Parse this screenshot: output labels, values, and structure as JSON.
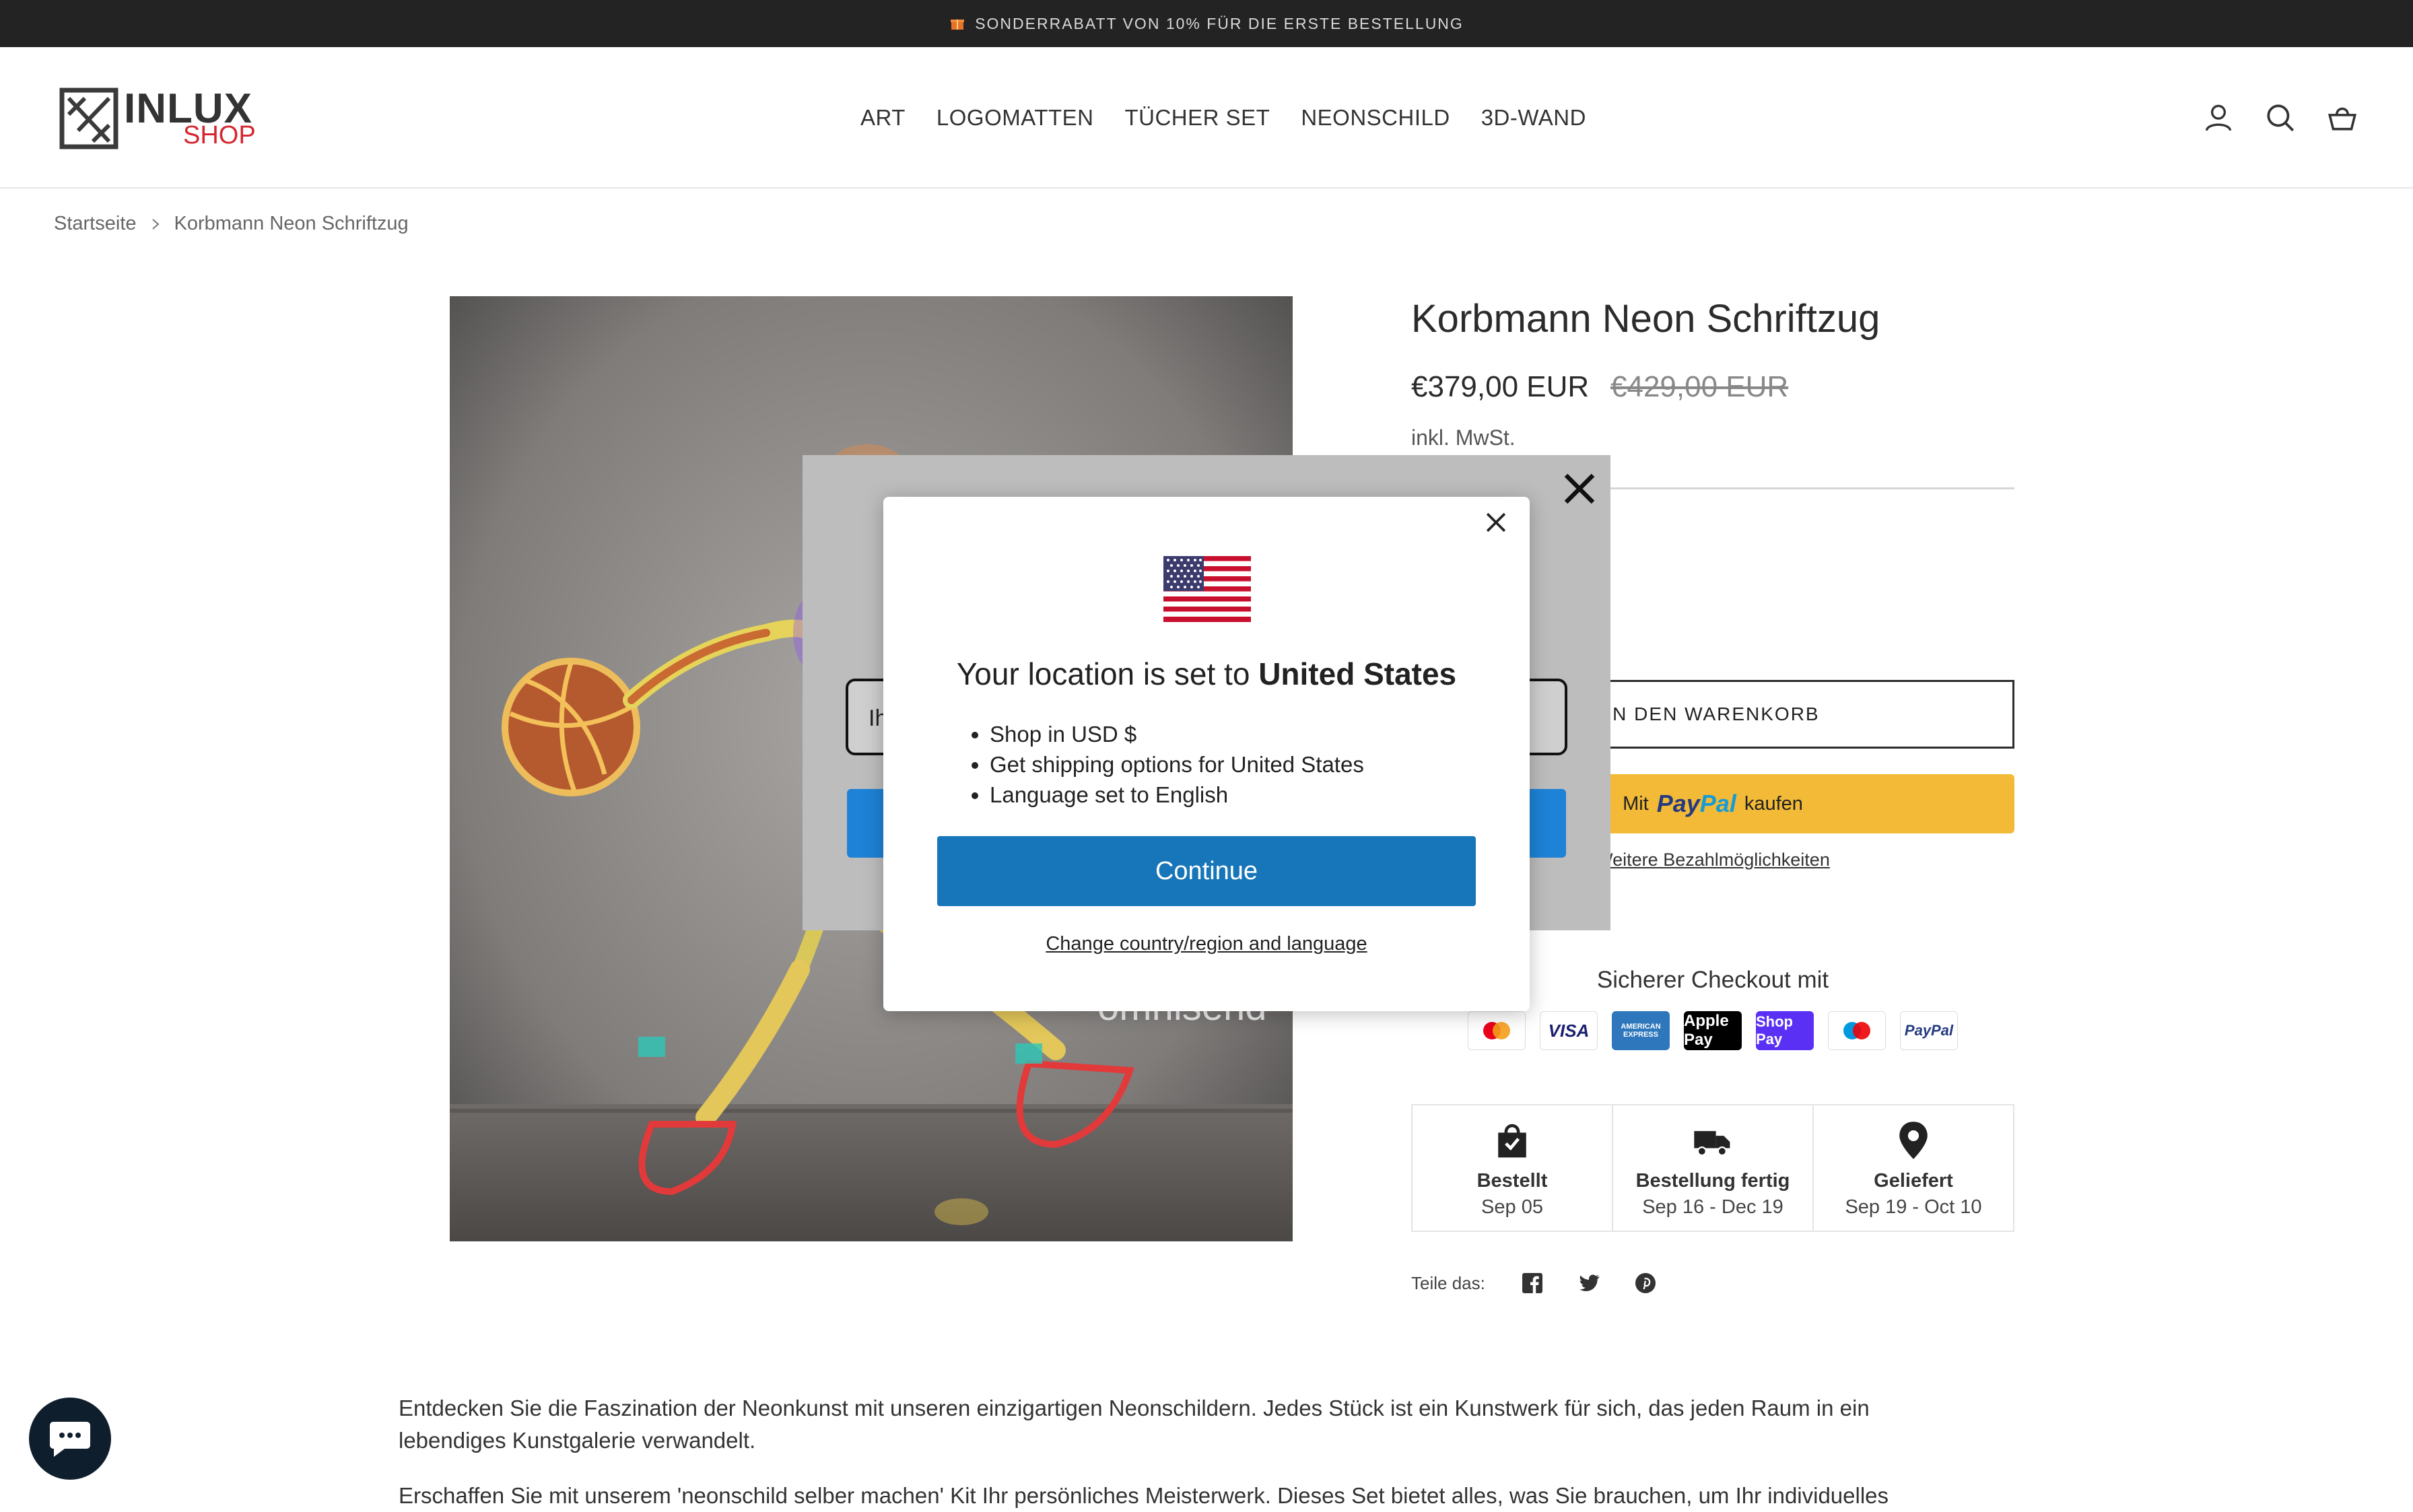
{
  "announcement": {
    "text": "SONDERRABATT VON 10% FÜR DIE ERSTE BESTELLUNG",
    "icon": "gift-icon"
  },
  "logo": {
    "main": "INLUX",
    "sub": "SHOP"
  },
  "nav": {
    "items": [
      "ART",
      "LOGOMATTEN",
      "TÜCHER SET",
      "NEONSCHILD",
      "3D-WAND"
    ]
  },
  "header_icons": [
    "account-icon",
    "search-icon",
    "cart-icon"
  ],
  "breadcrumb": {
    "home": "Startseite",
    "current": "Korbmann Neon Schriftzug"
  },
  "product": {
    "title": "Korbmann Neon Schriftzug",
    "price": "€379,00 EUR",
    "compare_price": "€429,00 EUR",
    "tax_note": "inkl. MwSt.",
    "add_to_cart": "IN DEN WARENKORB",
    "paypal_prefix": "Mit",
    "paypal_brand_a": "Pay",
    "paypal_brand_b": "Pal",
    "paypal_suffix": "kaufen",
    "more_payment": "Weitere Bezahlmöglichkeiten",
    "secure_checkout": "Sicherer Checkout mit",
    "payment_methods": [
      "Mastercard",
      "VISA",
      "AMERICAN EXPRESS",
      "Apple Pay",
      "Shop Pay",
      "Maestro",
      "PayPal"
    ]
  },
  "delivery": [
    {
      "title": "Bestellt",
      "date": "Sep 05",
      "icon": "shopping-bag-icon"
    },
    {
      "title": "Bestellung fertig",
      "date": "Sep 16 - Dec 19",
      "icon": "truck-icon"
    },
    {
      "title": "Geliefert",
      "date": "Sep 19 - Oct 10",
      "icon": "location-pin-icon"
    }
  ],
  "share": {
    "label": "Teile das:",
    "icons": [
      "facebook-icon",
      "twitter-icon",
      "pinterest-icon"
    ]
  },
  "description": {
    "p1": "Entdecken Sie die Faszination der Neonkunst mit unseren einzigartigen Neonschildern. Jedes Stück ist ein Kunstwerk für sich, das jeden Raum in ein lebendiges Kunstgalerie verwandelt.",
    "p2": "Erschaffen Sie mit unserem 'neonschild selber machen' Kit Ihr persönliches Meisterwerk. Dieses Set bietet alles, was Sie brauchen, um Ihr individuelles"
  },
  "omnisend_popup": {
    "input_placeholder": "Ih",
    "brand": "omnisend"
  },
  "location_modal": {
    "title_prefix": "Your location is set to",
    "country": "United States",
    "items": [
      "Shop in USD $",
      "Get shipping options for United States",
      "Language set to English"
    ],
    "continue": "Continue",
    "change_link": "Change country/region and language"
  },
  "colors": {
    "announcement_bg": "#232323",
    "paypal_yellow": "#f2ba36",
    "continue_blue": "#1776b9",
    "omnisend_blue": "#1e82d6",
    "logo_red": "#d5262e"
  }
}
